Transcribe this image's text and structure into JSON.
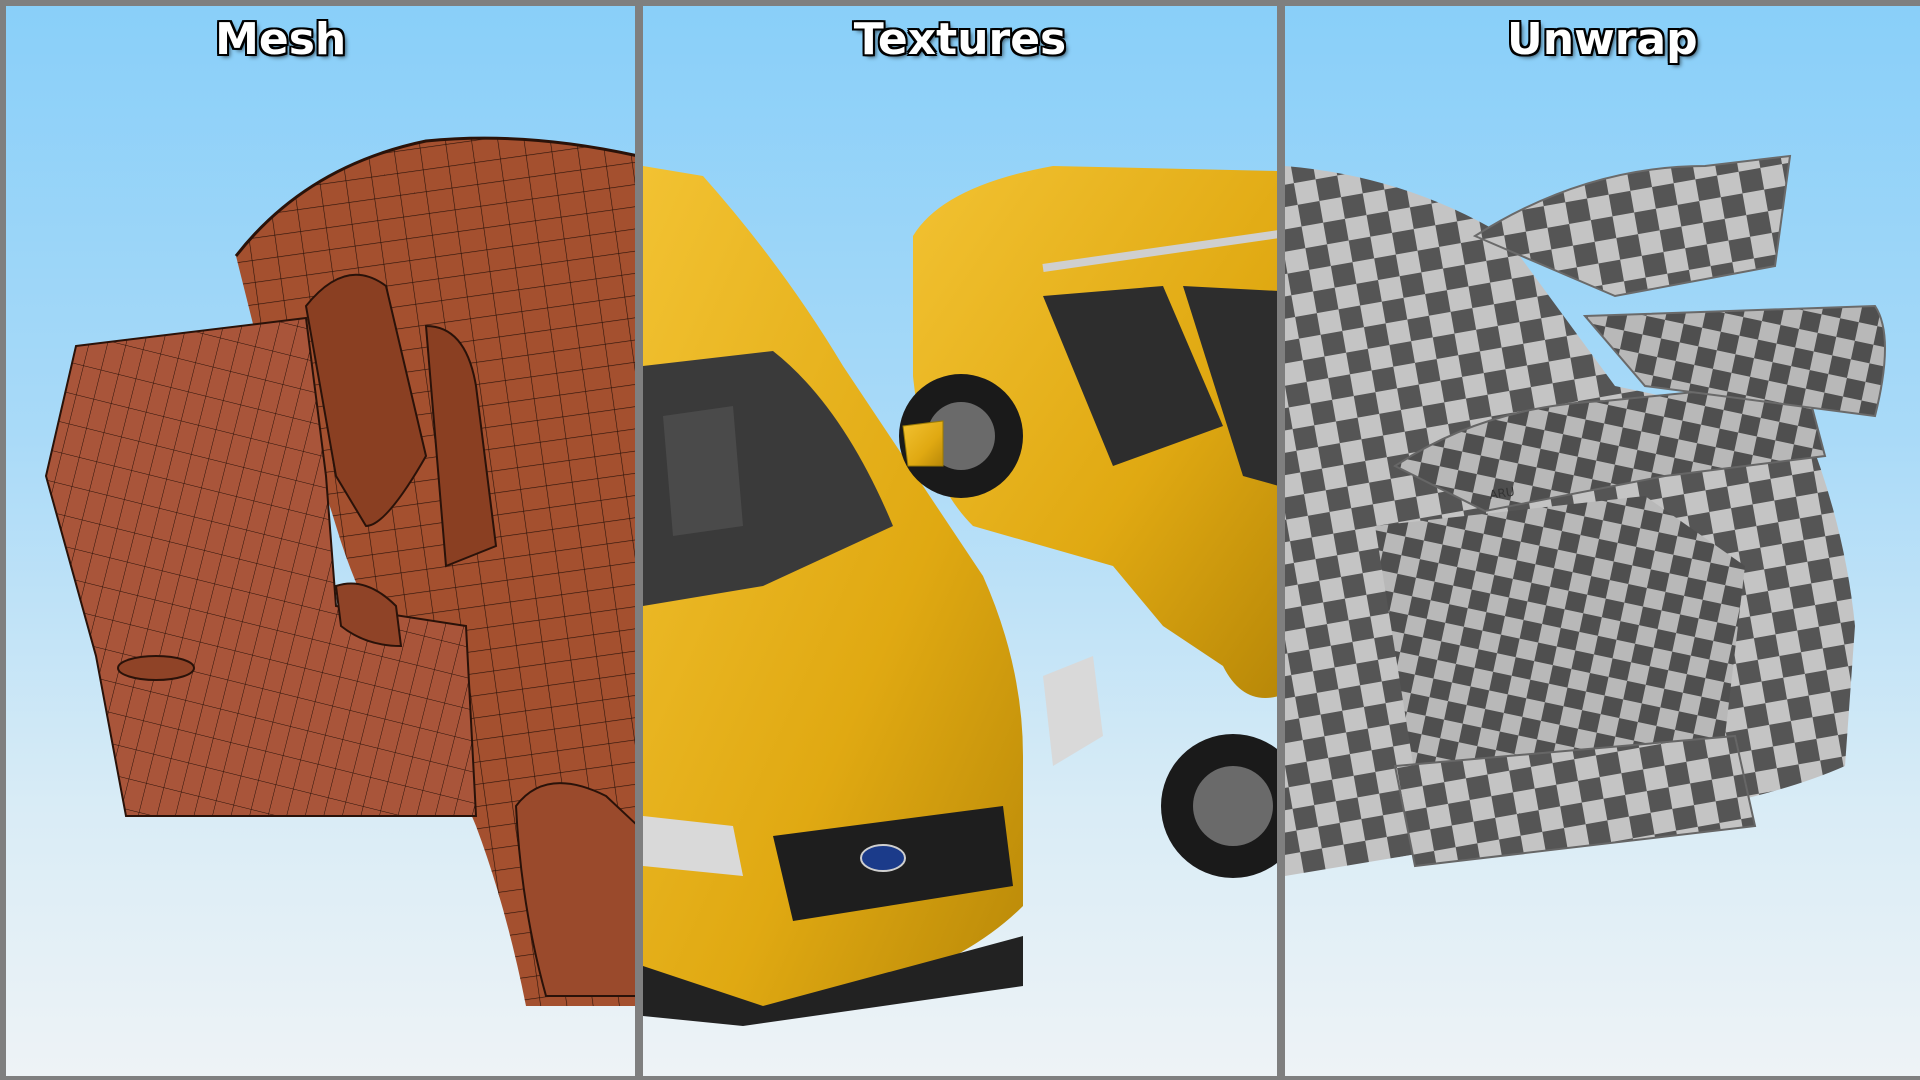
{
  "panels": [
    {
      "title": "Mesh"
    },
    {
      "title": "Textures"
    },
    {
      "title": "Unwrap"
    }
  ],
  "colors": {
    "mesh_body": "#a4502f",
    "mesh_lines": "#2a1209",
    "texture_yellow": "#e6b21a",
    "texture_dark": "#2a2a2a",
    "checker_light": "#bdbdbd",
    "checker_dark": "#5a5a5a",
    "divider": "#7f7f7f"
  },
  "badge_text": "SUBARU"
}
